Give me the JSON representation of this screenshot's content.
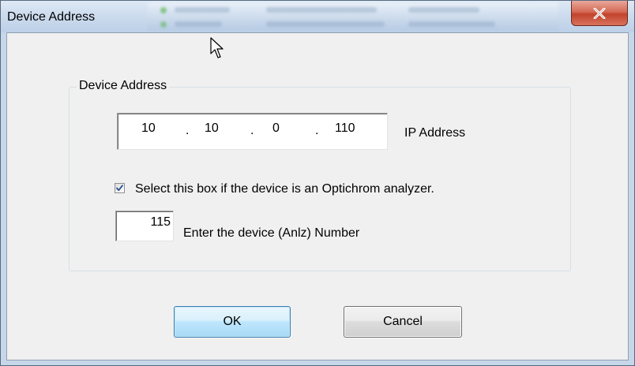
{
  "window": {
    "title": "Device Address"
  },
  "group": {
    "label": "Device Address"
  },
  "ip": {
    "octets": [
      "10",
      "10",
      "0",
      "110"
    ],
    "separator": ".",
    "label": "IP Address"
  },
  "optichrom": {
    "checked": true,
    "label": "Select this box if the device is an Optichrom analyzer."
  },
  "device_number": {
    "value": "115",
    "label": "Enter the device (Anlz) Number"
  },
  "buttons": {
    "ok": "OK",
    "cancel": "Cancel"
  },
  "icons": {
    "close": "close-icon",
    "check": "checkmark-icon",
    "cursor": "mouse-pointer-icon"
  },
  "colors": {
    "close_button": "#c2432c",
    "ok_button_border": "#3c7fb1",
    "dialog_background": "#f0f0f0"
  }
}
